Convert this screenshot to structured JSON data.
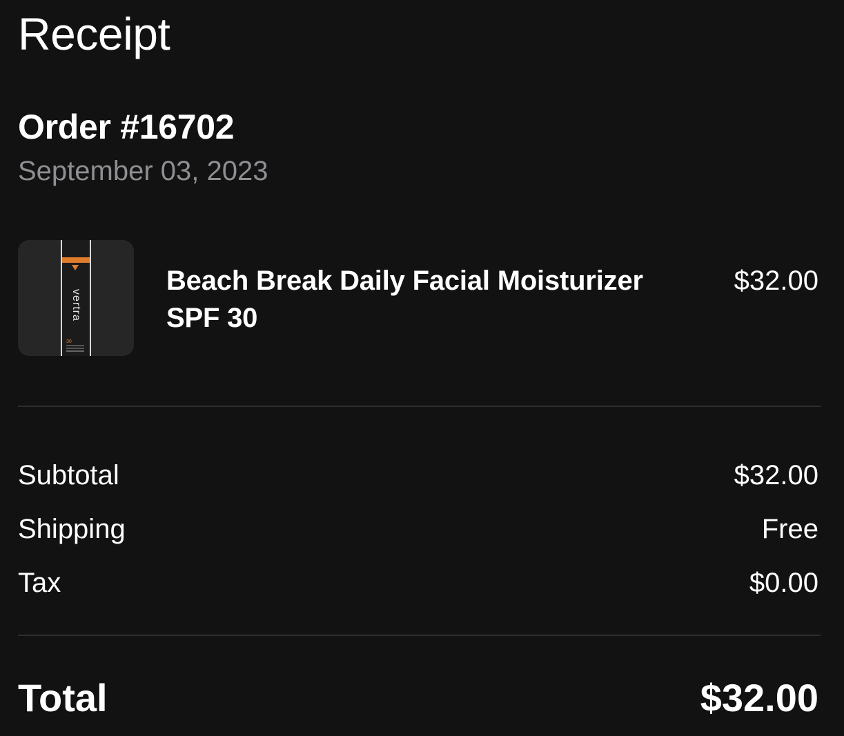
{
  "header": {
    "title": "Receipt"
  },
  "order": {
    "number": "Order #16702",
    "date": "September 03, 2023"
  },
  "items": [
    {
      "name": "Beach Break Daily Facial Moisturizer SPF 30",
      "price": "$32.00",
      "thumbnail": {
        "brand_text": "vertra",
        "spf_text": "30",
        "accent_color": "#e07c2c"
      }
    }
  ],
  "summary": {
    "subtotal": {
      "label": "Subtotal",
      "value": "$32.00"
    },
    "shipping": {
      "label": "Shipping",
      "value": "Free"
    },
    "tax": {
      "label": "Tax",
      "value": "$0.00"
    }
  },
  "total": {
    "label": "Total",
    "value": "$32.00"
  },
  "colors": {
    "background": "#121212",
    "text_primary": "#ffffff",
    "text_secondary": "#8e8e93",
    "divider": "#2e2e2e"
  }
}
